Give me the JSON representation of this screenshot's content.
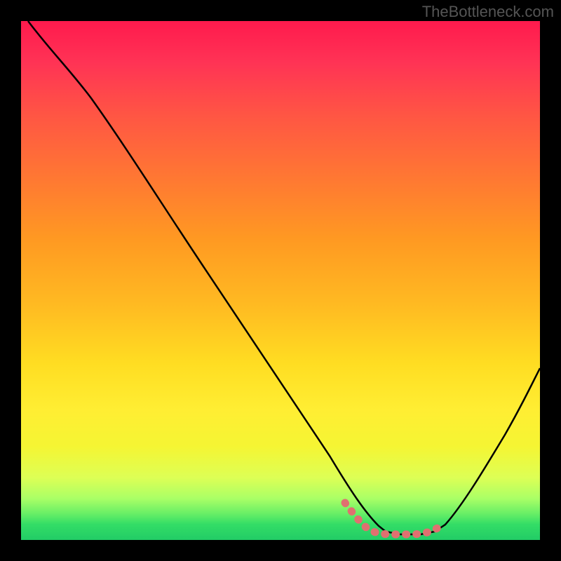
{
  "watermark": "TheBottleneck.com",
  "chart_data": {
    "type": "line",
    "title": "",
    "xlabel": "",
    "ylabel": "",
    "xlim": [
      0,
      100
    ],
    "ylim": [
      0,
      100
    ],
    "x": [
      0,
      5,
      10,
      15,
      20,
      25,
      30,
      35,
      40,
      45,
      50,
      55,
      60,
      62,
      65,
      68,
      72,
      75,
      78,
      80,
      85,
      90,
      95,
      100
    ],
    "values": [
      100,
      97,
      93,
      88,
      82,
      75,
      68,
      60,
      52,
      44,
      35,
      26,
      16,
      10,
      5,
      2,
      0.5,
      0.5,
      0.5,
      2,
      8,
      16,
      25,
      34
    ],
    "highlight_region": {
      "x_start": 62,
      "x_end": 80,
      "color": "#e07070"
    },
    "background_gradient": {
      "top": "#ff1a4d",
      "mid": "#ffdd22",
      "bottom": "#22cc66"
    }
  }
}
